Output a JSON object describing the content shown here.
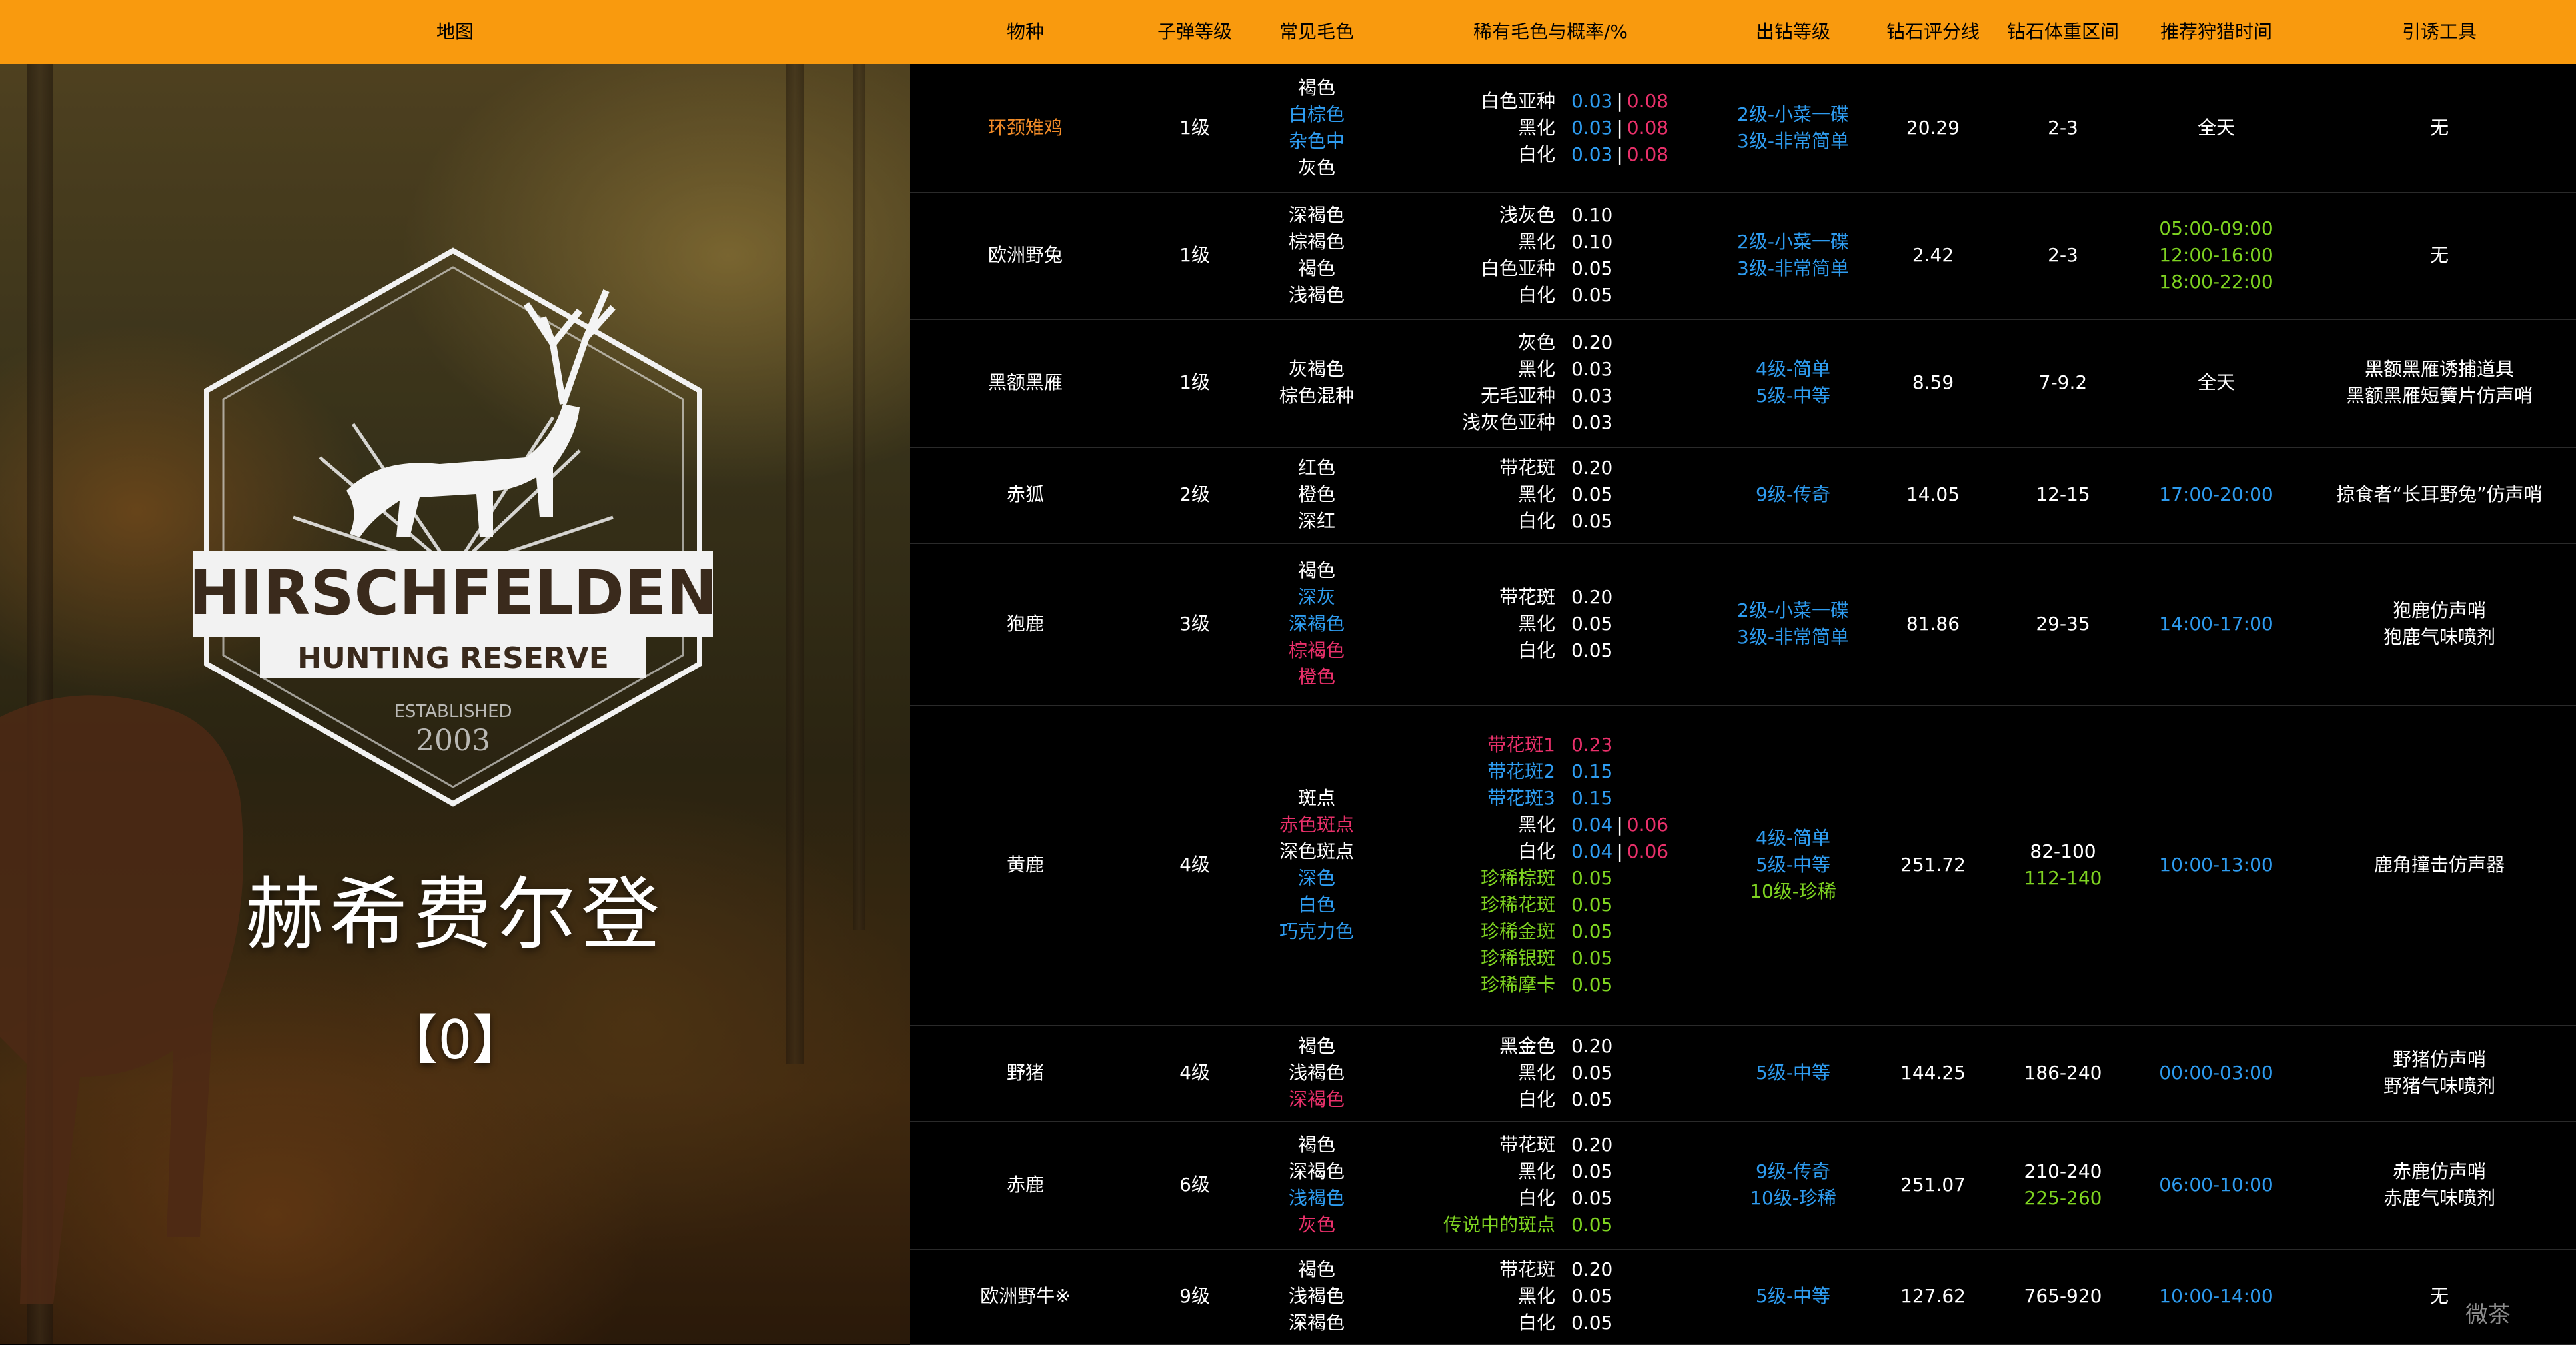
{
  "header": {
    "map": "地图",
    "species": "物种",
    "ammo": "子弹等级",
    "common": "常见毛色",
    "rare": "稀有毛色与概率/%",
    "diamond_level": "出钻等级",
    "diamond_score": "钻石评分线",
    "diamond_weight": "钻石体重区间",
    "time": "推荐狩猎时间",
    "lure": "引诱工具"
  },
  "map_panel": {
    "logo_line1": "HIRSCHFELDEN",
    "logo_line2": "HUNTING RESERVE",
    "logo_est": "ESTABLISHED",
    "logo_year": "2003",
    "map_name": "赫希费尔登",
    "map_code": "【0】"
  },
  "watermark": "微茶",
  "colors": {
    "header_bg": "#f99a0e",
    "white": "#ffffff",
    "blue": "#2e9cf0",
    "pink": "#e9306a",
    "green": "#7ed321",
    "orange": "#f28c28"
  },
  "rows": [
    {
      "species": "环颈雉鸡",
      "species_color": "orange",
      "ammo": "1级",
      "common": [
        {
          "t": "褐色",
          "c": "white"
        },
        {
          "t": "白棕色",
          "c": "blue"
        },
        {
          "t": "杂色中",
          "c": "blue"
        },
        {
          "t": "灰色",
          "c": "white"
        }
      ],
      "rare": [
        {
          "n": "白色亚种",
          "v": [
            {
              "t": "0.03",
              "c": "blue"
            },
            {
              "t": "0.08",
              "c": "pink"
            }
          ]
        },
        {
          "n": "黑化",
          "v": [
            {
              "t": "0.03",
              "c": "blue"
            },
            {
              "t": "0.08",
              "c": "pink"
            }
          ]
        },
        {
          "n": "白化",
          "v": [
            {
              "t": "0.03",
              "c": "blue"
            },
            {
              "t": "0.08",
              "c": "pink"
            }
          ]
        }
      ],
      "levels": [
        {
          "t": "2级-小菜一碟",
          "c": "blue"
        },
        {
          "t": "3级-非常简单",
          "c": "blue"
        }
      ],
      "score": "20.29",
      "weight": [
        {
          "t": "2-3",
          "c": "white"
        }
      ],
      "time": [
        {
          "t": "全天",
          "c": "white"
        }
      ],
      "lure": [
        "无"
      ]
    },
    {
      "species": "欧洲野兔",
      "species_color": "white",
      "ammo": "1级",
      "common": [
        {
          "t": "深褐色",
          "c": "white"
        },
        {
          "t": "棕褐色",
          "c": "white"
        },
        {
          "t": "褐色",
          "c": "white"
        },
        {
          "t": "浅褐色",
          "c": "white"
        }
      ],
      "rare": [
        {
          "n": "浅灰色",
          "v": [
            {
              "t": "0.10",
              "c": "white"
            }
          ]
        },
        {
          "n": "黑化",
          "v": [
            {
              "t": "0.10",
              "c": "white"
            }
          ]
        },
        {
          "n": "白色亚种",
          "v": [
            {
              "t": "0.05",
              "c": "white"
            }
          ]
        },
        {
          "n": "白化",
          "v": [
            {
              "t": "0.05",
              "c": "white"
            }
          ]
        }
      ],
      "levels": [
        {
          "t": "2级-小菜一碟",
          "c": "blue"
        },
        {
          "t": "3级-非常简单",
          "c": "blue"
        }
      ],
      "score": "2.42",
      "weight": [
        {
          "t": "2-3",
          "c": "white"
        }
      ],
      "time": [
        {
          "t": "05:00-09:00",
          "c": "green"
        },
        {
          "t": "12:00-16:00",
          "c": "green"
        },
        {
          "t": "18:00-22:00",
          "c": "green"
        }
      ],
      "lure": [
        "无"
      ]
    },
    {
      "species": "黑额黑雁",
      "species_color": "white",
      "ammo": "1级",
      "common": [
        {
          "t": "灰褐色",
          "c": "white"
        },
        {
          "t": "棕色混种",
          "c": "white"
        }
      ],
      "rare": [
        {
          "n": "灰色",
          "v": [
            {
              "t": "0.20",
              "c": "white"
            }
          ]
        },
        {
          "n": "黑化",
          "v": [
            {
              "t": "0.03",
              "c": "white"
            }
          ]
        },
        {
          "n": "无毛亚种",
          "v": [
            {
              "t": "0.03",
              "c": "white"
            }
          ]
        },
        {
          "n": "浅灰色亚种",
          "v": [
            {
              "t": "0.03",
              "c": "white"
            }
          ]
        }
      ],
      "levels": [
        {
          "t": "4级-简单",
          "c": "blue"
        },
        {
          "t": "5级-中等",
          "c": "blue"
        }
      ],
      "score": "8.59",
      "weight": [
        {
          "t": "7-9.2",
          "c": "white"
        }
      ],
      "time": [
        {
          "t": "全天",
          "c": "white"
        }
      ],
      "lure": [
        "黑额黑雁诱捕道具",
        "黑额黑雁短簧片仿声哨"
      ]
    },
    {
      "species": "赤狐",
      "species_color": "white",
      "ammo": "2级",
      "common": [
        {
          "t": "红色",
          "c": "white"
        },
        {
          "t": "橙色",
          "c": "white"
        },
        {
          "t": "深红",
          "c": "white"
        }
      ],
      "rare": [
        {
          "n": "带花斑",
          "v": [
            {
              "t": "0.20",
              "c": "white"
            }
          ]
        },
        {
          "n": "黑化",
          "v": [
            {
              "t": "0.05",
              "c": "white"
            }
          ]
        },
        {
          "n": "白化",
          "v": [
            {
              "t": "0.05",
              "c": "white"
            }
          ]
        }
      ],
      "levels": [
        {
          "t": "9级-传奇",
          "c": "blue"
        }
      ],
      "score": "14.05",
      "weight": [
        {
          "t": "12-15",
          "c": "white"
        }
      ],
      "time": [
        {
          "t": "17:00-20:00",
          "c": "blue"
        }
      ],
      "lure": [
        "掠食者“长耳野兔”仿声哨"
      ]
    },
    {
      "species": "狍鹿",
      "species_color": "white",
      "ammo": "3级",
      "common": [
        {
          "t": "褐色",
          "c": "white"
        },
        {
          "t": "深灰",
          "c": "blue"
        },
        {
          "t": "深褐色",
          "c": "blue"
        },
        {
          "t": "棕褐色",
          "c": "pink"
        },
        {
          "t": "橙色",
          "c": "pink"
        }
      ],
      "rare": [
        {
          "n": "带花斑",
          "v": [
            {
              "t": "0.20",
              "c": "white"
            }
          ]
        },
        {
          "n": "黑化",
          "v": [
            {
              "t": "0.05",
              "c": "white"
            }
          ]
        },
        {
          "n": "白化",
          "v": [
            {
              "t": "0.05",
              "c": "white"
            }
          ]
        }
      ],
      "levels": [
        {
          "t": "2级-小菜一碟",
          "c": "blue"
        },
        {
          "t": "3级-非常简单",
          "c": "blue"
        }
      ],
      "score": "81.86",
      "weight": [
        {
          "t": "29-35",
          "c": "white"
        }
      ],
      "time": [
        {
          "t": "14:00-17:00",
          "c": "blue"
        }
      ],
      "lure": [
        "狍鹿仿声哨",
        "狍鹿气味喷剂"
      ]
    },
    {
      "species": "黄鹿",
      "species_color": "white",
      "ammo": "4级",
      "common": [
        {
          "t": "斑点",
          "c": "white"
        },
        {
          "t": "赤色斑点",
          "c": "pink"
        },
        {
          "t": "深色斑点",
          "c": "white"
        },
        {
          "t": "深色",
          "c": "blue"
        },
        {
          "t": "白色",
          "c": "blue"
        },
        {
          "t": "巧克力色",
          "c": "blue"
        }
      ],
      "rare": [
        {
          "n": "带花斑1",
          "nc": "pink",
          "v": [
            {
              "t": "0.23",
              "c": "pink"
            }
          ]
        },
        {
          "n": "带花斑2",
          "nc": "blue",
          "v": [
            {
              "t": "0.15",
              "c": "blue"
            }
          ]
        },
        {
          "n": "带花斑3",
          "nc": "blue",
          "v": [
            {
              "t": "0.15",
              "c": "blue"
            }
          ]
        },
        {
          "n": "黑化",
          "v": [
            {
              "t": "0.04",
              "c": "blue"
            },
            {
              "t": "0.06",
              "c": "pink"
            }
          ]
        },
        {
          "n": "白化",
          "v": [
            {
              "t": "0.04",
              "c": "blue"
            },
            {
              "t": "0.06",
              "c": "pink"
            }
          ]
        },
        {
          "n": "珍稀棕斑",
          "nc": "green",
          "v": [
            {
              "t": "0.05",
              "c": "green"
            }
          ]
        },
        {
          "n": "珍稀花斑",
          "nc": "green",
          "v": [
            {
              "t": "0.05",
              "c": "green"
            }
          ]
        },
        {
          "n": "珍稀金斑",
          "nc": "green",
          "v": [
            {
              "t": "0.05",
              "c": "green"
            }
          ]
        },
        {
          "n": "珍稀银斑",
          "nc": "green",
          "v": [
            {
              "t": "0.05",
              "c": "green"
            }
          ]
        },
        {
          "n": "珍稀摩卡",
          "nc": "green",
          "v": [
            {
              "t": "0.05",
              "c": "green"
            }
          ]
        }
      ],
      "levels": [
        {
          "t": "4级-简单",
          "c": "blue"
        },
        {
          "t": "5级-中等",
          "c": "blue"
        },
        {
          "t": "10级-珍稀",
          "c": "green"
        }
      ],
      "score": "251.72",
      "weight": [
        {
          "t": "82-100",
          "c": "white"
        },
        {
          "t": "112-140",
          "c": "green"
        }
      ],
      "time": [
        {
          "t": "10:00-13:00",
          "c": "blue"
        }
      ],
      "lure": [
        "鹿角撞击仿声器"
      ]
    },
    {
      "species": "野猪",
      "species_color": "white",
      "ammo": "4级",
      "common": [
        {
          "t": "褐色",
          "c": "white"
        },
        {
          "t": "浅褐色",
          "c": "white"
        },
        {
          "t": "深褐色",
          "c": "pink"
        }
      ],
      "rare": [
        {
          "n": "黑金色",
          "v": [
            {
              "t": "0.20",
              "c": "white"
            }
          ]
        },
        {
          "n": "黑化",
          "v": [
            {
              "t": "0.05",
              "c": "white"
            }
          ]
        },
        {
          "n": "白化",
          "v": [
            {
              "t": "0.05",
              "c": "white"
            }
          ]
        }
      ],
      "levels": [
        {
          "t": "5级-中等",
          "c": "blue"
        }
      ],
      "score": "144.25",
      "weight": [
        {
          "t": "186-240",
          "c": "white"
        }
      ],
      "time": [
        {
          "t": "00:00-03:00",
          "c": "blue"
        }
      ],
      "lure": [
        "野猪仿声哨",
        "野猪气味喷剂"
      ]
    },
    {
      "species": "赤鹿",
      "species_color": "white",
      "ammo": "6级",
      "common": [
        {
          "t": "褐色",
          "c": "white"
        },
        {
          "t": "深褐色",
          "c": "white"
        },
        {
          "t": "浅褐色",
          "c": "blue"
        },
        {
          "t": "灰色",
          "c": "pink"
        }
      ],
      "rare": [
        {
          "n": "带花斑",
          "v": [
            {
              "t": "0.20",
              "c": "white"
            }
          ]
        },
        {
          "n": "黑化",
          "v": [
            {
              "t": "0.05",
              "c": "white"
            }
          ]
        },
        {
          "n": "白化",
          "v": [
            {
              "t": "0.05",
              "c": "white"
            }
          ]
        },
        {
          "n": "传说中的斑点",
          "nc": "green",
          "v": [
            {
              "t": "0.05",
              "c": "green"
            }
          ]
        }
      ],
      "levels": [
        {
          "t": "9级-传奇",
          "c": "blue"
        },
        {
          "t": "10级-珍稀",
          "c": "blue"
        }
      ],
      "score": "251.07",
      "weight": [
        {
          "t": "210-240",
          "c": "white"
        },
        {
          "t": "225-260",
          "c": "green"
        }
      ],
      "time": [
        {
          "t": "06:00-10:00",
          "c": "blue"
        }
      ],
      "lure": [
        "赤鹿仿声哨",
        "赤鹿气味喷剂"
      ]
    },
    {
      "species": "欧洲野牛※",
      "species_color": "white",
      "ammo": "9级",
      "common": [
        {
          "t": "褐色",
          "c": "white"
        },
        {
          "t": "浅褐色",
          "c": "white"
        },
        {
          "t": "深褐色",
          "c": "white"
        }
      ],
      "rare": [
        {
          "n": "带花斑",
          "v": [
            {
              "t": "0.20",
              "c": "white"
            }
          ]
        },
        {
          "n": "黑化",
          "v": [
            {
              "t": "0.05",
              "c": "white"
            }
          ]
        },
        {
          "n": "白化",
          "v": [
            {
              "t": "0.05",
              "c": "white"
            }
          ]
        }
      ],
      "levels": [
        {
          "t": "5级-中等",
          "c": "blue"
        }
      ],
      "score": "127.62",
      "weight": [
        {
          "t": "765-920",
          "c": "white"
        }
      ],
      "time": [
        {
          "t": "10:00-14:00",
          "c": "blue"
        }
      ],
      "lure": [
        "无"
      ]
    }
  ]
}
